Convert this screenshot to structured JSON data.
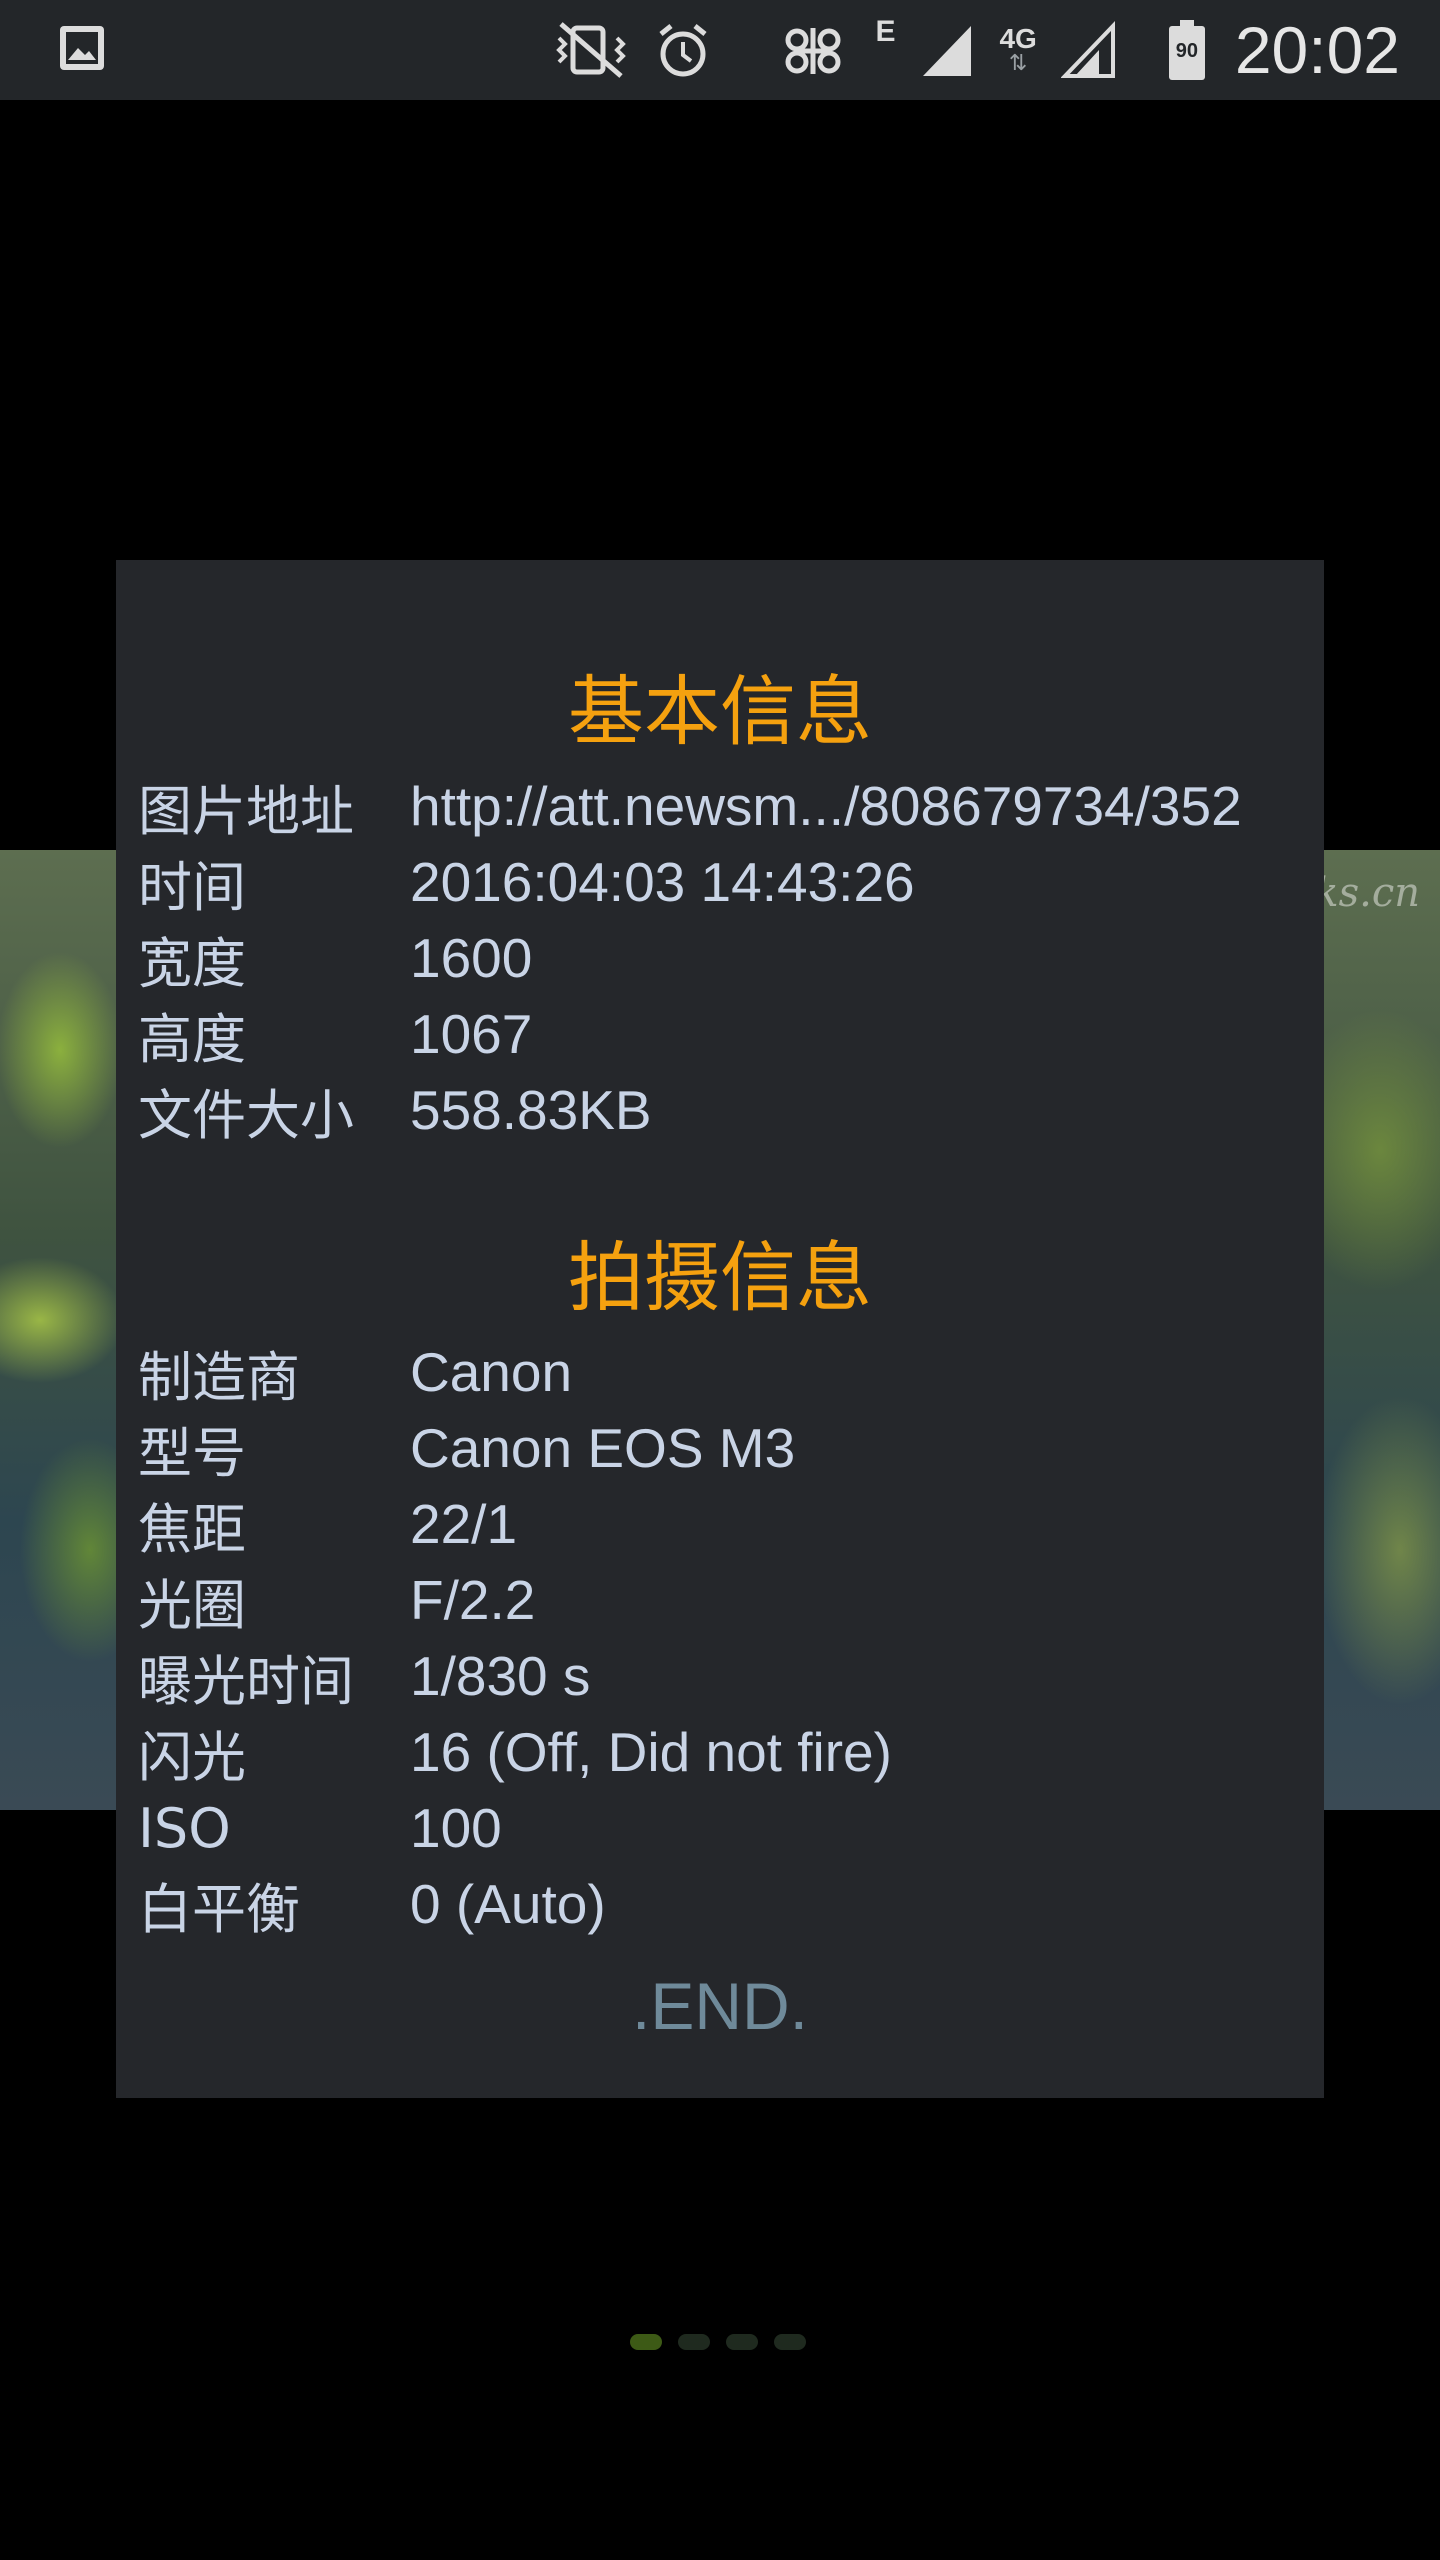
{
  "status_bar": {
    "time": "20:02",
    "network_e": "E",
    "network_4g": "4G",
    "battery_level": "90",
    "icons": [
      "gallery-icon",
      "vibrate-mute-icon",
      "alarm-icon",
      "china-unicom-icon",
      "signal-icon",
      "signal-icon-2",
      "battery-icon"
    ]
  },
  "photo": {
    "watermark": "ks.cn"
  },
  "dialog": {
    "basic_title": "基本信息",
    "basic_rows": [
      {
        "label": "图片地址",
        "value": "http://att.newsm.../808679734/352"
      },
      {
        "label": "时间",
        "value": "2016:04:03 14:43:26"
      },
      {
        "label": "宽度",
        "value": "1600"
      },
      {
        "label": "高度",
        "value": "1067"
      },
      {
        "label": "文件大小",
        "value": "558.83KB"
      }
    ],
    "shoot_title": "拍摄信息",
    "shoot_rows": [
      {
        "label": "制造商",
        "value": "Canon"
      },
      {
        "label": "型号",
        "value": "Canon EOS M3"
      },
      {
        "label": "焦距",
        "value": "22/1"
      },
      {
        "label": "光圈",
        "value": "F/2.2"
      },
      {
        "label": "曝光时间",
        "value": "1/830 s"
      },
      {
        "label": "闪光",
        "value": "16 (Off, Did not fire)"
      },
      {
        "label": "ISO",
        "value": "100"
      },
      {
        "label": "白平衡",
        "value": "0 (Auto)"
      }
    ],
    "end_text": ".END."
  },
  "pager": {
    "total": 4,
    "active": 1
  },
  "colors": {
    "title": "#f5a10f",
    "text": "#c9d4e6",
    "end": "#6f8a9a",
    "dialog_bg": "#25272b"
  }
}
